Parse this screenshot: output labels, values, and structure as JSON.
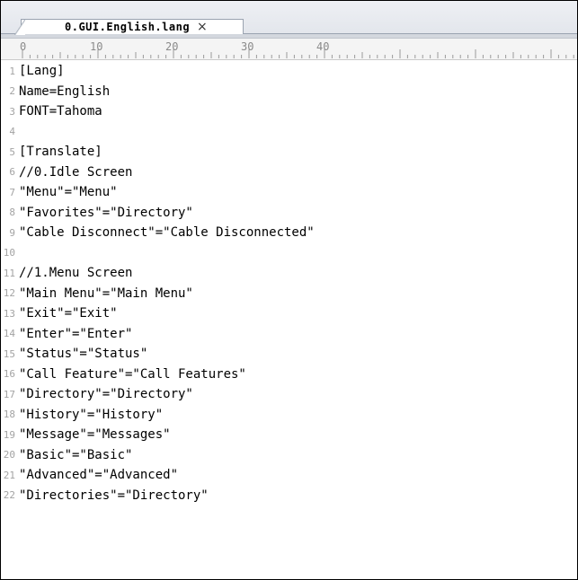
{
  "tab": {
    "title": "0.GUI.English.lang",
    "close_glyph": "×"
  },
  "ruler": {
    "labels": [
      "0",
      "10",
      "20",
      "30",
      "40"
    ]
  },
  "lines": [
    {
      "n": "1",
      "text": "[Lang]"
    },
    {
      "n": "2",
      "text": "Name=English"
    },
    {
      "n": "3",
      "text": "FONT=Tahoma"
    },
    {
      "n": "4",
      "text": ""
    },
    {
      "n": "5",
      "text": "[Translate]"
    },
    {
      "n": "6",
      "text": "//0.Idle Screen"
    },
    {
      "n": "7",
      "text": "\"Menu\"=\"Menu\""
    },
    {
      "n": "8",
      "text": "\"Favorites\"=\"Directory\""
    },
    {
      "n": "9",
      "text": "\"Cable Disconnect\"=\"Cable Disconnected\""
    },
    {
      "n": "10",
      "text": ""
    },
    {
      "n": "11",
      "text": "//1.Menu Screen"
    },
    {
      "n": "12",
      "text": "\"Main Menu\"=\"Main Menu\""
    },
    {
      "n": "13",
      "text": "\"Exit\"=\"Exit\""
    },
    {
      "n": "14",
      "text": "\"Enter\"=\"Enter\""
    },
    {
      "n": "15",
      "text": "\"Status\"=\"Status\""
    },
    {
      "n": "16",
      "text": "\"Call Feature\"=\"Call Features\""
    },
    {
      "n": "17",
      "text": "\"Directory\"=\"Directory\""
    },
    {
      "n": "18",
      "text": "\"History\"=\"History\""
    },
    {
      "n": "19",
      "text": "\"Message\"=\"Messages\""
    },
    {
      "n": "20",
      "text": "\"Basic\"=\"Basic\""
    },
    {
      "n": "21",
      "text": "\"Advanced\"=\"Advanced\""
    },
    {
      "n": "22",
      "text": "\"Directories\"=\"Directory\""
    }
  ]
}
